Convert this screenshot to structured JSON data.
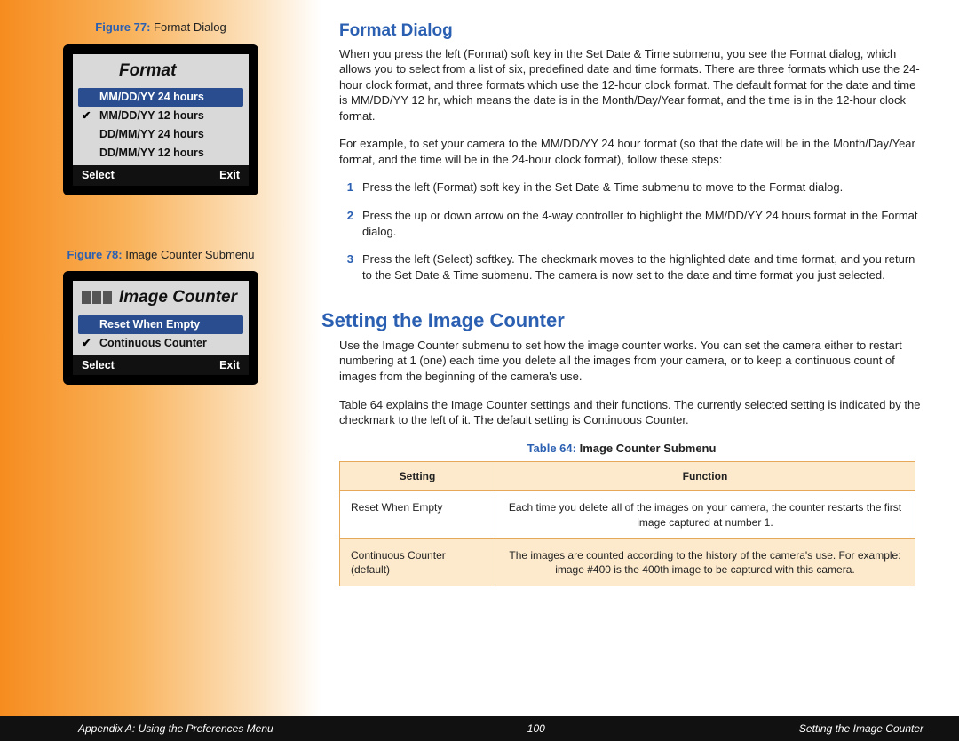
{
  "figures": {
    "fig77": {
      "num": "Figure 77:",
      "caption": "Format Dialog",
      "screen_title": "Format",
      "items": [
        {
          "label": "MM/DD/YY 24 hours",
          "highlighted": true,
          "checked": false
        },
        {
          "label": "MM/DD/YY 12 hours",
          "highlighted": false,
          "checked": true
        },
        {
          "label": "DD/MM/YY 24 hours",
          "highlighted": false,
          "checked": false
        },
        {
          "label": "DD/MM/YY 12 hours",
          "highlighted": false,
          "checked": false
        }
      ],
      "sk_left": "Select",
      "sk_right": "Exit"
    },
    "fig78": {
      "num": "Figure 78:",
      "caption": "Image Counter Submenu",
      "screen_title": "Image Counter",
      "items": [
        {
          "label": "Reset When Empty",
          "highlighted": true,
          "checked": false
        },
        {
          "label": "Continuous Counter",
          "highlighted": false,
          "checked": true
        }
      ],
      "sk_left": "Select",
      "sk_right": "Exit"
    }
  },
  "sections": {
    "format_dialog": {
      "heading": "Format Dialog",
      "para1": "When you press the left (Format) soft key in the Set Date & Time submenu, you see the Format dialog, which allows you to select from a list of six, predefined date and time formats. There are three formats which use the 24-hour clock format, and three formats which use the 12-hour clock format. The default format for the date and time is MM/DD/YY 12 hr, which means the date is in the Month/Day/Year format, and the time is in the 12-hour clock format.",
      "para2": "For example, to set your camera to the MM/DD/YY 24 hour format (so that the date will be in the Month/Day/Year format, and the time will be in the 24-hour clock format), follow these steps:",
      "steps": [
        "Press the left (Format) soft key in the Set Date & Time submenu to move to the Format dialog.",
        "Press the up or down arrow on the 4-way controller to highlight the MM/DD/YY 24 hours format in the Format dialog.",
        "Press the left (Select) softkey. The checkmark moves to the highlighted date and time format, and you return to the Set Date & Time submenu. The camera is now set to the date and time format you just selected."
      ],
      "step_nums": [
        "1",
        "2",
        "3"
      ]
    },
    "image_counter": {
      "heading": "Setting the Image Counter",
      "para1": "Use the Image Counter submenu to set how the image counter works. You can set the camera either to restart numbering at 1 (one) each time you delete all the images from your camera, or to keep a continuous count of images from the beginning of the camera's use.",
      "para2": "Table 64 explains the Image Counter settings and their functions. The currently selected setting is indicated by the checkmark to the left of it. The default setting is Continuous Counter."
    }
  },
  "table": {
    "num": "Table 64:",
    "caption": "Image Counter Submenu",
    "headers": {
      "setting": "Setting",
      "function": "Function"
    },
    "rows": [
      {
        "setting": "Reset When Empty",
        "function": "Each time you delete all of the images on your camera, the counter restarts the first image captured at number 1."
      },
      {
        "setting": "Continuous Counter (default)",
        "function": "The images are counted according to the history of the camera's use. For example: image #400 is the 400th image to be captured with this camera."
      }
    ]
  },
  "footer": {
    "left": "Appendix A: Using the Preferences Menu",
    "center": "100",
    "right": "Setting the Image Counter"
  }
}
